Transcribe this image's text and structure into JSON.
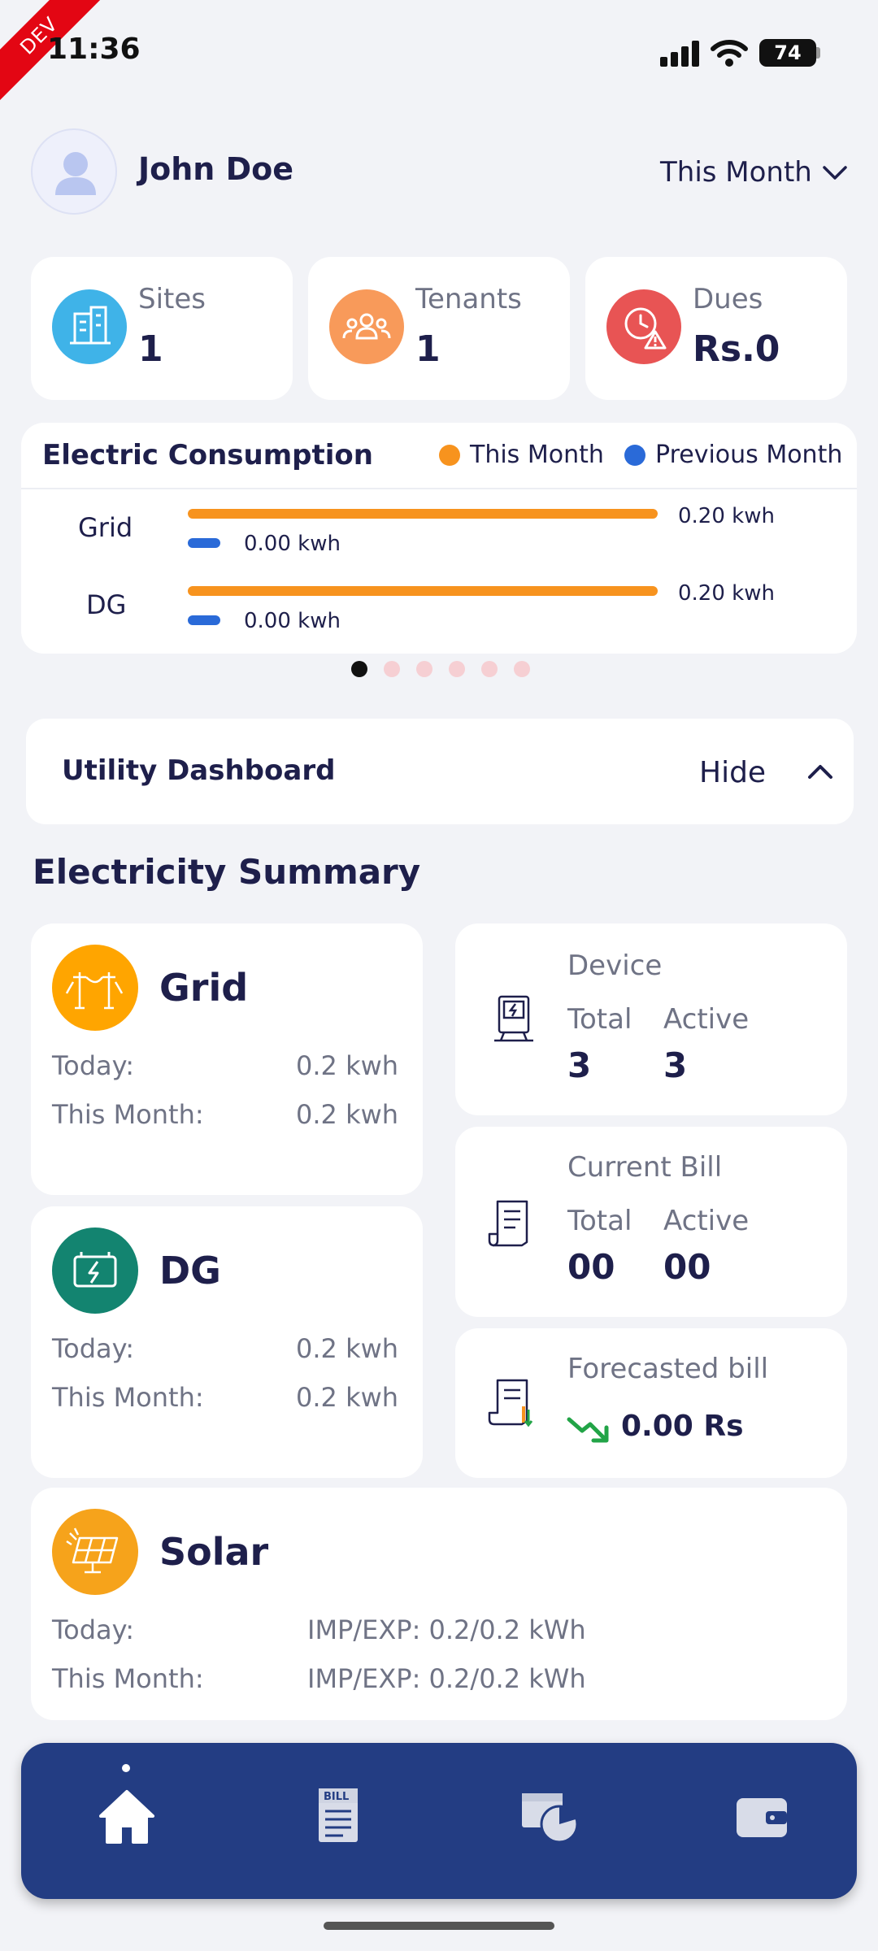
{
  "status_bar": {
    "env_badge": "DEV",
    "time": "11:36",
    "battery": "74"
  },
  "header": {
    "user_name": "John Doe",
    "period": "This Month"
  },
  "stats": [
    {
      "label": "Sites",
      "value": "1",
      "icon": "building-icon",
      "color": "#3fb3e8"
    },
    {
      "label": "Tenants",
      "value": "1",
      "icon": "people-group-icon",
      "color": "#f89a5a"
    },
    {
      "label": "Dues",
      "value": "Rs.0",
      "icon": "clock-warning-icon",
      "color": "#e85454"
    }
  ],
  "consumption": {
    "title": "Electric Consumption",
    "legend": {
      "this_month": "This Month",
      "previous_month": "Previous Month"
    },
    "colors": {
      "this_month": "#f7931e",
      "previous_month": "#2a6ad8"
    },
    "rows": [
      {
        "label": "Grid",
        "this_month": "0.20 kwh",
        "previous_month": "0.00 kwh"
      },
      {
        "label": "DG",
        "this_month": "0.20 kwh",
        "previous_month": "0.00 kwh"
      }
    ]
  },
  "pager": {
    "count": 6,
    "active": 0
  },
  "utility_dashboard": {
    "title": "Utility Dashboard",
    "toggle_label": "Hide"
  },
  "summary": {
    "title": "Electricity Summary",
    "grid": {
      "name": "Grid",
      "today_label": "Today:",
      "today_value": "0.2 kwh",
      "month_label": "This Month:",
      "month_value": "0.2 kwh"
    },
    "dg": {
      "name": "DG",
      "today_label": "Today:",
      "today_value": "0.2 kwh",
      "month_label": "This Month:",
      "month_value": "0.2 kwh"
    },
    "solar": {
      "name": "Solar",
      "today_label": "Today:",
      "today_value": "IMP/EXP: 0.2/0.2 kWh",
      "month_label": "This Month:",
      "month_value": "IMP/EXP: 0.2/0.2 kWh"
    },
    "device": {
      "title": "Device",
      "total_label": "Total",
      "active_label": "Active",
      "total": "3",
      "active": "3"
    },
    "current_bill": {
      "title": "Current Bill",
      "total_label": "Total",
      "active_label": "Active",
      "total": "00",
      "active": "00"
    },
    "forecast": {
      "title": "Forecasted bill",
      "value": "0.00 Rs"
    }
  },
  "nav": [
    {
      "name": "home",
      "icon": "home-icon"
    },
    {
      "name": "bill",
      "icon": "bill-icon",
      "text": "BILL"
    },
    {
      "name": "reports",
      "icon": "report-chart-icon"
    },
    {
      "name": "wallet",
      "icon": "wallet-icon"
    }
  ]
}
